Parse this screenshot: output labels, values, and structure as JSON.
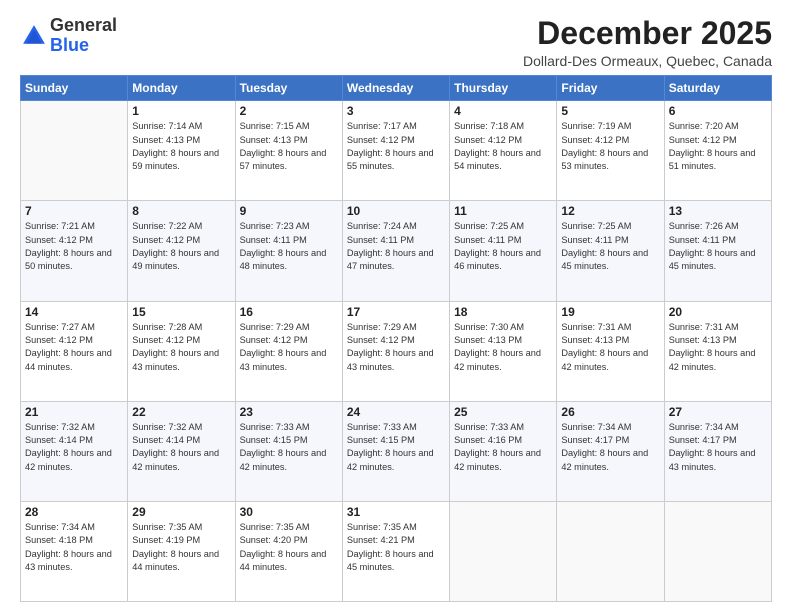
{
  "header": {
    "logo_line1": "General",
    "logo_line2": "Blue",
    "month_title": "December 2025",
    "location": "Dollard-Des Ormeaux, Quebec, Canada"
  },
  "days_of_week": [
    "Sunday",
    "Monday",
    "Tuesday",
    "Wednesday",
    "Thursday",
    "Friday",
    "Saturday"
  ],
  "weeks": [
    [
      {
        "day": "",
        "sunrise": "",
        "sunset": "",
        "daylight": ""
      },
      {
        "day": "1",
        "sunrise": "Sunrise: 7:14 AM",
        "sunset": "Sunset: 4:13 PM",
        "daylight": "Daylight: 8 hours and 59 minutes."
      },
      {
        "day": "2",
        "sunrise": "Sunrise: 7:15 AM",
        "sunset": "Sunset: 4:13 PM",
        "daylight": "Daylight: 8 hours and 57 minutes."
      },
      {
        "day": "3",
        "sunrise": "Sunrise: 7:17 AM",
        "sunset": "Sunset: 4:12 PM",
        "daylight": "Daylight: 8 hours and 55 minutes."
      },
      {
        "day": "4",
        "sunrise": "Sunrise: 7:18 AM",
        "sunset": "Sunset: 4:12 PM",
        "daylight": "Daylight: 8 hours and 54 minutes."
      },
      {
        "day": "5",
        "sunrise": "Sunrise: 7:19 AM",
        "sunset": "Sunset: 4:12 PM",
        "daylight": "Daylight: 8 hours and 53 minutes."
      },
      {
        "day": "6",
        "sunrise": "Sunrise: 7:20 AM",
        "sunset": "Sunset: 4:12 PM",
        "daylight": "Daylight: 8 hours and 51 minutes."
      }
    ],
    [
      {
        "day": "7",
        "sunrise": "Sunrise: 7:21 AM",
        "sunset": "Sunset: 4:12 PM",
        "daylight": "Daylight: 8 hours and 50 minutes."
      },
      {
        "day": "8",
        "sunrise": "Sunrise: 7:22 AM",
        "sunset": "Sunset: 4:12 PM",
        "daylight": "Daylight: 8 hours and 49 minutes."
      },
      {
        "day": "9",
        "sunrise": "Sunrise: 7:23 AM",
        "sunset": "Sunset: 4:11 PM",
        "daylight": "Daylight: 8 hours and 48 minutes."
      },
      {
        "day": "10",
        "sunrise": "Sunrise: 7:24 AM",
        "sunset": "Sunset: 4:11 PM",
        "daylight": "Daylight: 8 hours and 47 minutes."
      },
      {
        "day": "11",
        "sunrise": "Sunrise: 7:25 AM",
        "sunset": "Sunset: 4:11 PM",
        "daylight": "Daylight: 8 hours and 46 minutes."
      },
      {
        "day": "12",
        "sunrise": "Sunrise: 7:25 AM",
        "sunset": "Sunset: 4:11 PM",
        "daylight": "Daylight: 8 hours and 45 minutes."
      },
      {
        "day": "13",
        "sunrise": "Sunrise: 7:26 AM",
        "sunset": "Sunset: 4:11 PM",
        "daylight": "Daylight: 8 hours and 45 minutes."
      }
    ],
    [
      {
        "day": "14",
        "sunrise": "Sunrise: 7:27 AM",
        "sunset": "Sunset: 4:12 PM",
        "daylight": "Daylight: 8 hours and 44 minutes."
      },
      {
        "day": "15",
        "sunrise": "Sunrise: 7:28 AM",
        "sunset": "Sunset: 4:12 PM",
        "daylight": "Daylight: 8 hours and 43 minutes."
      },
      {
        "day": "16",
        "sunrise": "Sunrise: 7:29 AM",
        "sunset": "Sunset: 4:12 PM",
        "daylight": "Daylight: 8 hours and 43 minutes."
      },
      {
        "day": "17",
        "sunrise": "Sunrise: 7:29 AM",
        "sunset": "Sunset: 4:12 PM",
        "daylight": "Daylight: 8 hours and 43 minutes."
      },
      {
        "day": "18",
        "sunrise": "Sunrise: 7:30 AM",
        "sunset": "Sunset: 4:13 PM",
        "daylight": "Daylight: 8 hours and 42 minutes."
      },
      {
        "day": "19",
        "sunrise": "Sunrise: 7:31 AM",
        "sunset": "Sunset: 4:13 PM",
        "daylight": "Daylight: 8 hours and 42 minutes."
      },
      {
        "day": "20",
        "sunrise": "Sunrise: 7:31 AM",
        "sunset": "Sunset: 4:13 PM",
        "daylight": "Daylight: 8 hours and 42 minutes."
      }
    ],
    [
      {
        "day": "21",
        "sunrise": "Sunrise: 7:32 AM",
        "sunset": "Sunset: 4:14 PM",
        "daylight": "Daylight: 8 hours and 42 minutes."
      },
      {
        "day": "22",
        "sunrise": "Sunrise: 7:32 AM",
        "sunset": "Sunset: 4:14 PM",
        "daylight": "Daylight: 8 hours and 42 minutes."
      },
      {
        "day": "23",
        "sunrise": "Sunrise: 7:33 AM",
        "sunset": "Sunset: 4:15 PM",
        "daylight": "Daylight: 8 hours and 42 minutes."
      },
      {
        "day": "24",
        "sunrise": "Sunrise: 7:33 AM",
        "sunset": "Sunset: 4:15 PM",
        "daylight": "Daylight: 8 hours and 42 minutes."
      },
      {
        "day": "25",
        "sunrise": "Sunrise: 7:33 AM",
        "sunset": "Sunset: 4:16 PM",
        "daylight": "Daylight: 8 hours and 42 minutes."
      },
      {
        "day": "26",
        "sunrise": "Sunrise: 7:34 AM",
        "sunset": "Sunset: 4:17 PM",
        "daylight": "Daylight: 8 hours and 42 minutes."
      },
      {
        "day": "27",
        "sunrise": "Sunrise: 7:34 AM",
        "sunset": "Sunset: 4:17 PM",
        "daylight": "Daylight: 8 hours and 43 minutes."
      }
    ],
    [
      {
        "day": "28",
        "sunrise": "Sunrise: 7:34 AM",
        "sunset": "Sunset: 4:18 PM",
        "daylight": "Daylight: 8 hours and 43 minutes."
      },
      {
        "day": "29",
        "sunrise": "Sunrise: 7:35 AM",
        "sunset": "Sunset: 4:19 PM",
        "daylight": "Daylight: 8 hours and 44 minutes."
      },
      {
        "day": "30",
        "sunrise": "Sunrise: 7:35 AM",
        "sunset": "Sunset: 4:20 PM",
        "daylight": "Daylight: 8 hours and 44 minutes."
      },
      {
        "day": "31",
        "sunrise": "Sunrise: 7:35 AM",
        "sunset": "Sunset: 4:21 PM",
        "daylight": "Daylight: 8 hours and 45 minutes."
      },
      {
        "day": "",
        "sunrise": "",
        "sunset": "",
        "daylight": ""
      },
      {
        "day": "",
        "sunrise": "",
        "sunset": "",
        "daylight": ""
      },
      {
        "day": "",
        "sunrise": "",
        "sunset": "",
        "daylight": ""
      }
    ]
  ]
}
